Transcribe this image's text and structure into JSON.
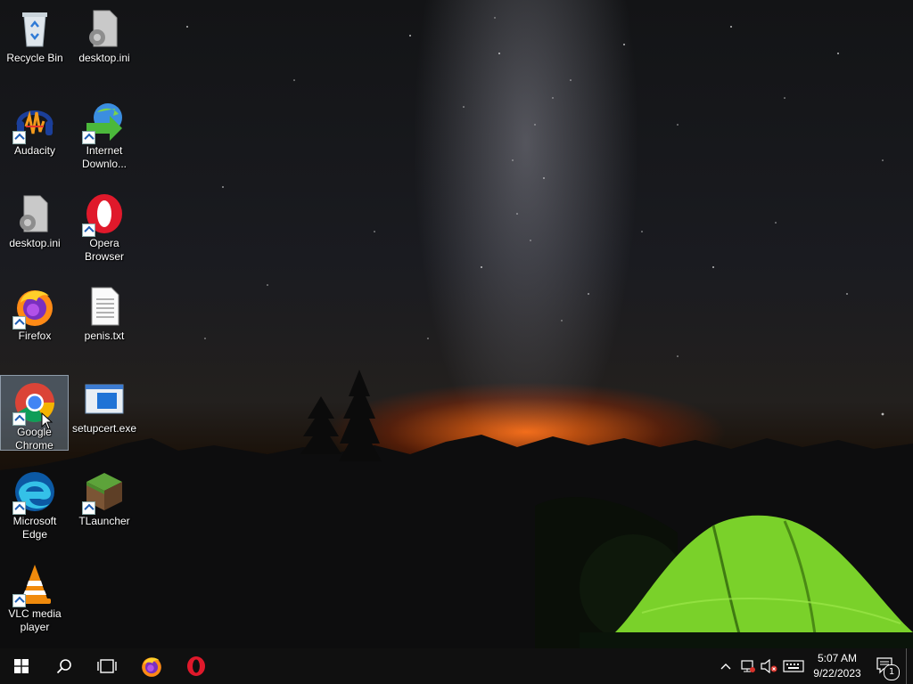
{
  "desktop": {
    "icons": [
      {
        "label": "Recycle Bin"
      },
      {
        "label": "desktop.ini"
      },
      {
        "label": "Audacity"
      },
      {
        "label": "Internet Downlo..."
      },
      {
        "label": "desktop.ini"
      },
      {
        "label": "Opera Browser"
      },
      {
        "label": "Firefox"
      },
      {
        "label": "penis.txt"
      },
      {
        "label": "Google Chrome"
      },
      {
        "label": "setupcert.exe"
      },
      {
        "label": "Microsoft Edge"
      },
      {
        "label": "TLauncher"
      },
      {
        "label": "VLC media player"
      }
    ]
  },
  "taskbar": {
    "clock_time": "5:07 AM",
    "clock_date": "9/22/2023",
    "notification_count": "1",
    "pinned": [
      "start-icon",
      "search-icon",
      "task-view-icon",
      "firefox-icon",
      "opera-icon"
    ]
  },
  "colors": {
    "taskbar_bg": "#101010",
    "selection": "#96b4d2"
  }
}
